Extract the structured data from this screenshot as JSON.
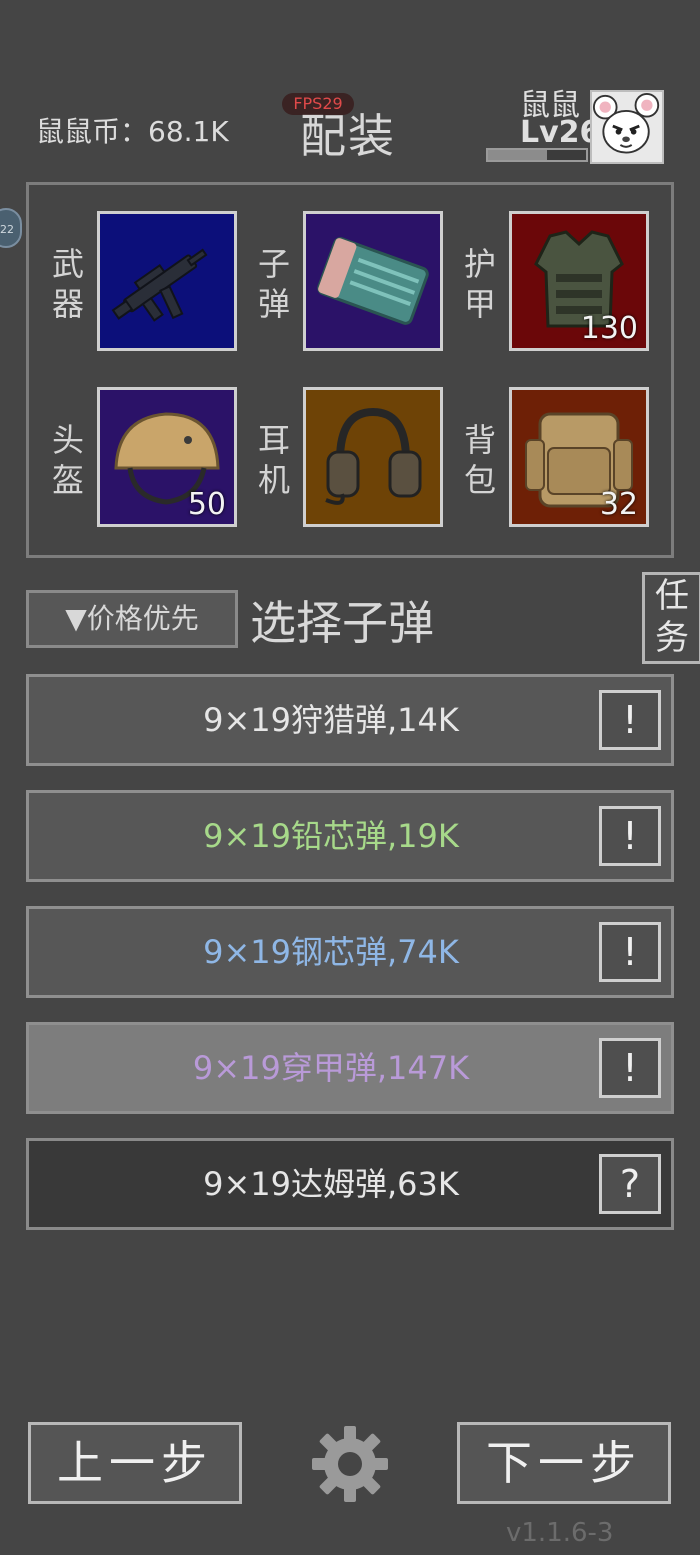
{
  "header": {
    "coin_text": "鼠鼠币：68.1K",
    "fps": "FPS29",
    "title": "配装",
    "player_name": "鼠鼠",
    "player_level": "Lv26",
    "xp_fraction": 0.6
  },
  "side_badge": "22",
  "equipment": {
    "weapon_label": [
      "武",
      "器"
    ],
    "ammo_label": [
      "子",
      "弹"
    ],
    "armor_label": [
      "护",
      "甲"
    ],
    "helmet_label": [
      "头",
      "盔"
    ],
    "headset_label": [
      "耳",
      "机"
    ],
    "backpack_label": [
      "背",
      "包"
    ],
    "armor_count": "130",
    "helmet_count": "50",
    "backpack_count": "32",
    "colors": {
      "weapon_bg": "#0c0f7a",
      "ammo_bg": "#2b1268",
      "armor_bg": "#6b0709",
      "helmet_bg": "#2b1268",
      "headset_bg": "#6e4306",
      "backpack_bg": "#6e2006"
    }
  },
  "sort_button": "▼价格优先",
  "select_title": "选择子弹",
  "task_button": [
    "任",
    "务"
  ],
  "ammo_list": [
    {
      "text": "9×19狩猎弹,14K",
      "color": "#e6e6e6",
      "info": "!"
    },
    {
      "text": "9×19铅芯弹,19K",
      "color": "#a7d98a",
      "info": "!"
    },
    {
      "text": "9×19钢芯弹,74K",
      "color": "#8fb7e6",
      "info": "!"
    },
    {
      "text": "9×19穿甲弹,147K",
      "color": "#b99ad8",
      "info": "!"
    },
    {
      "text": "9×19达姆弹,63K",
      "color": "#e6e6e6",
      "info": "?"
    }
  ],
  "footer": {
    "prev": "上一步",
    "next": "下一步",
    "version": "v1.1.6-3"
  }
}
